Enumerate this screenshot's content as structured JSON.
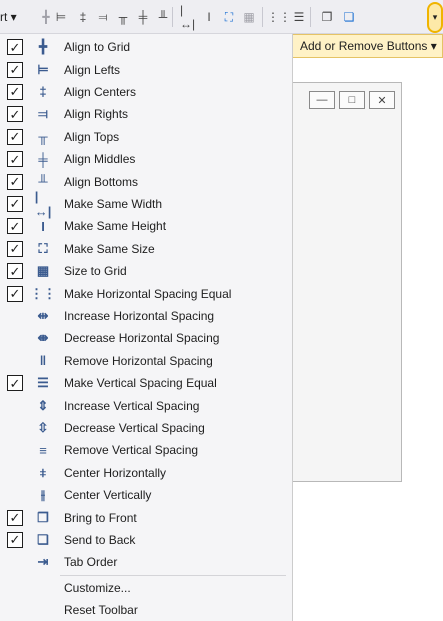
{
  "toolbar": {
    "partial_text": "rt ▾",
    "overflow_glyph": "▾",
    "buttons": [
      {
        "name": "align-to-grid-icon",
        "glyph": "╋",
        "style": "dim"
      },
      {
        "name": "align-lefts-icon",
        "glyph": "⊨",
        "style": ""
      },
      {
        "name": "align-centers-icon",
        "glyph": "‡",
        "style": ""
      },
      {
        "name": "align-rights-icon",
        "glyph": "⫤",
        "style": ""
      },
      {
        "name": "align-tops-icon",
        "glyph": "╥",
        "style": ""
      },
      {
        "name": "align-middles-icon",
        "glyph": "╪",
        "style": ""
      },
      {
        "name": "align-bottoms-icon",
        "glyph": "╨",
        "style": ""
      },
      {
        "name": "make-same-width-icon",
        "glyph": "|↔|",
        "style": ""
      },
      {
        "name": "make-same-height-icon",
        "glyph": "I",
        "style": ""
      },
      {
        "name": "make-same-size-icon",
        "glyph": "⛶",
        "style": "blue"
      },
      {
        "name": "size-to-grid-icon",
        "glyph": "▦",
        "style": "dim"
      },
      {
        "name": "horizontal-spacing-equal-icon",
        "glyph": "⋮⋮",
        "style": ""
      },
      {
        "name": "vertical-spacing-equal-icon",
        "glyph": "☰",
        "style": ""
      },
      {
        "name": "bring-to-front-icon",
        "glyph": "❐",
        "style": ""
      },
      {
        "name": "send-to-back-icon",
        "glyph": "❏",
        "style": "blue"
      }
    ]
  },
  "add_remove": {
    "label": "Add or Remove Buttons ▾"
  },
  "designer": {
    "minimize_glyph": "—",
    "maximize_glyph": "□",
    "close_glyph": "✕"
  },
  "menu": {
    "items": [
      {
        "label": "Align to Grid",
        "checked": true,
        "icon": "╋",
        "name": "align-to-grid"
      },
      {
        "label": "Align Lefts",
        "checked": true,
        "icon": "⊨",
        "name": "align-lefts"
      },
      {
        "label": "Align Centers",
        "checked": true,
        "icon": "‡",
        "name": "align-centers"
      },
      {
        "label": "Align Rights",
        "checked": true,
        "icon": "⫤",
        "name": "align-rights"
      },
      {
        "label": "Align Tops",
        "checked": true,
        "icon": "╥",
        "name": "align-tops"
      },
      {
        "label": "Align Middles",
        "checked": true,
        "icon": "╪",
        "name": "align-middles"
      },
      {
        "label": "Align Bottoms",
        "checked": true,
        "icon": "╨",
        "name": "align-bottoms"
      },
      {
        "label": "Make Same Width",
        "checked": true,
        "icon": "|↔|",
        "name": "make-same-width"
      },
      {
        "label": "Make Same Height",
        "checked": true,
        "icon": "I",
        "name": "make-same-height"
      },
      {
        "label": "Make Same Size",
        "checked": true,
        "icon": "⛶",
        "name": "make-same-size"
      },
      {
        "label": "Size to Grid",
        "checked": true,
        "icon": "▦",
        "name": "size-to-grid"
      },
      {
        "label": "Make Horizontal Spacing Equal",
        "checked": true,
        "icon": "⋮⋮",
        "name": "make-horizontal-spacing-equal"
      },
      {
        "label": "Increase Horizontal Spacing",
        "checked": false,
        "icon": "⇹",
        "name": "increase-horizontal-spacing"
      },
      {
        "label": "Decrease Horizontal Spacing",
        "checked": false,
        "icon": "⇼",
        "name": "decrease-horizontal-spacing"
      },
      {
        "label": "Remove Horizontal Spacing",
        "checked": false,
        "icon": "‖",
        "name": "remove-horizontal-spacing"
      },
      {
        "label": "Make Vertical Spacing Equal",
        "checked": true,
        "icon": "☰",
        "name": "make-vertical-spacing-equal"
      },
      {
        "label": "Increase Vertical Spacing",
        "checked": false,
        "icon": "⇕",
        "name": "increase-vertical-spacing"
      },
      {
        "label": "Decrease Vertical Spacing",
        "checked": false,
        "icon": "⇳",
        "name": "decrease-vertical-spacing"
      },
      {
        "label": "Remove Vertical Spacing",
        "checked": false,
        "icon": "≡",
        "name": "remove-vertical-spacing"
      },
      {
        "label": "Center Horizontally",
        "checked": false,
        "icon": "⧧",
        "name": "center-horizontally"
      },
      {
        "label": "Center Vertically",
        "checked": false,
        "icon": "⫲",
        "name": "center-vertically"
      },
      {
        "label": "Bring to Front",
        "checked": true,
        "icon": "❐",
        "name": "bring-to-front"
      },
      {
        "label": "Send to Back",
        "checked": true,
        "icon": "❏",
        "name": "send-to-back"
      },
      {
        "label": "Tab Order",
        "checked": false,
        "icon": "⇥",
        "name": "tab-order"
      },
      {
        "label": "Customize...",
        "checked": false,
        "icon": "",
        "name": "customize"
      },
      {
        "label": "Reset Toolbar",
        "checked": false,
        "icon": "",
        "name": "reset-toolbar"
      }
    ]
  }
}
